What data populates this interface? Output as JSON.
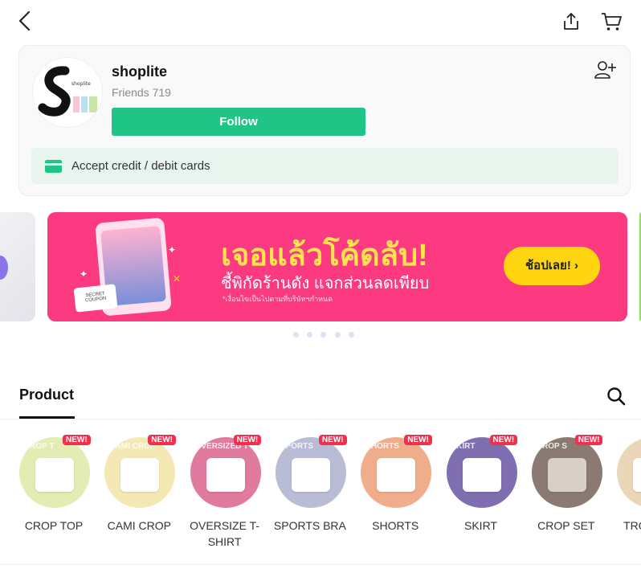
{
  "topbar": {
    "back_icon": "chevron-left-icon",
    "share_icon": "share-icon",
    "cart_icon": "cart-icon"
  },
  "shop": {
    "logo_text": "shoplite",
    "name": "shoplite",
    "friends": "Friends 719",
    "follow_label": "Follow",
    "add_friend_icon": "add-friend-icon",
    "payment_label": "Accept credit / debit cards",
    "accent": "#1fc586"
  },
  "banner": {
    "title": "เจอแล้วโค้ดลับ!",
    "subtitle": "ชี้พิกัดร้านดัง แจกส่วนลดเพียบ",
    "note": "*เงื่อนไขเป็นไปตามที่บริษัทฯกำหนด",
    "coupon_text": "SECRET COUPON",
    "cta": "ช้อปเลย! ›",
    "background": "#fb3a82",
    "cta_color": "#ffd50f",
    "active_slide": 1,
    "slide_count": 5
  },
  "tabs": {
    "product": "Product",
    "search_icon": "search-icon"
  },
  "categories": [
    {
      "label": "CROP TOP",
      "ghost": "CROP T",
      "badge": "NEW!",
      "bg": "#e4ecb4",
      "item": "#ffffff"
    },
    {
      "label": "CAMI CROP",
      "ghost": "CAMI CROP",
      "badge": "NEW!",
      "bg": "#f4e9b4",
      "item": "#ffffff"
    },
    {
      "label": "OVERSIZE T-SHIRT",
      "ghost": "OVERSIZED T",
      "badge": "NEW!",
      "bg": "#e07a9e",
      "item": "#ffffff"
    },
    {
      "label": "SPORTS BRA",
      "ghost": "SPORTS",
      "badge": "NEW!",
      "bg": "#b8bcd4",
      "item": "#ffffff"
    },
    {
      "label": "SHORTS",
      "ghost": "SHORTS",
      "badge": "NEW!",
      "bg": "#f0ad8c",
      "item": "#ffffff"
    },
    {
      "label": "SKIRT",
      "ghost": "SKIRT",
      "badge": "NEW!",
      "bg": "#7f6fb0",
      "item": "#ffffff"
    },
    {
      "label": "CROP SET",
      "ghost": "CROP S",
      "badge": "NEW!",
      "bg": "#8a7a72",
      "item": "#d8cfc7"
    },
    {
      "label": "TRO",
      "ghost": "",
      "badge": "",
      "bg": "#e9d7b8",
      "item": "#ffffff"
    }
  ]
}
